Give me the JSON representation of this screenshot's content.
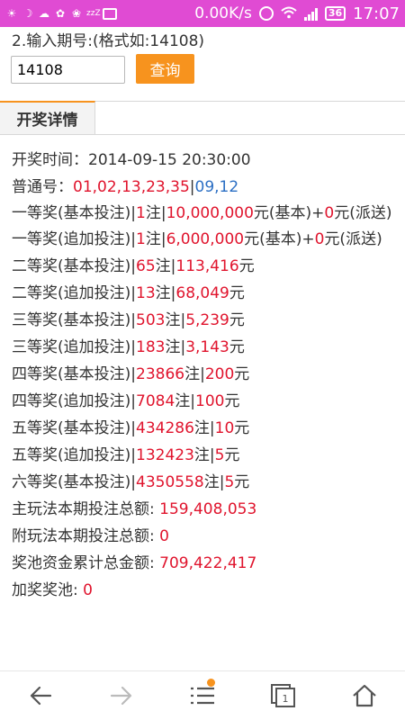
{
  "status_bar": {
    "speed": "0.00K/s",
    "battery": "36",
    "time": "17:07",
    "notification_icons": [
      "sun-icon",
      "moon-icon",
      "cloud-icon",
      "flower-icon",
      "flower-icon",
      "sleep-icon",
      "image-icon"
    ]
  },
  "query": {
    "hint": "2.输入期号:(格式如:14108)",
    "input_value": "14108",
    "button_label": "查询"
  },
  "tab": {
    "label": "开奖详情"
  },
  "results": {
    "draw_time_label": "开奖时间：",
    "draw_time": "2014-09-15 20:30:00",
    "numbers_label": "普通号：",
    "front_numbers": "01,02,13,23,35",
    "separator": "|",
    "back_numbers": "09,12",
    "prizes": [
      {
        "name": "一等奖(基本投注)|",
        "count": "1",
        "unit": "注|",
        "amount": "10,000,000",
        "suffix": "元(基本)+",
        "extra": "0",
        "extra_suffix": "元(派送)"
      },
      {
        "name": "一等奖(追加投注)|",
        "count": "1",
        "unit": "注|",
        "amount": "6,000,000",
        "suffix": "元(基本)+",
        "extra": "0",
        "extra_suffix": "元(派送)"
      },
      {
        "name": "二等奖(基本投注)|",
        "count": "65",
        "unit": "注|",
        "amount": "113,416",
        "suffix": "元"
      },
      {
        "name": "二等奖(追加投注)|",
        "count": "13",
        "unit": "注|",
        "amount": "68,049",
        "suffix": "元"
      },
      {
        "name": "三等奖(基本投注)|",
        "count": "503",
        "unit": "注|",
        "amount": "5,239",
        "suffix": "元"
      },
      {
        "name": "三等奖(追加投注)|",
        "count": "183",
        "unit": "注|",
        "amount": "3,143",
        "suffix": "元"
      },
      {
        "name": "四等奖(基本投注)|",
        "count": "23866",
        "unit": "注|",
        "amount": "200",
        "suffix": "元"
      },
      {
        "name": "四等奖(追加投注)|",
        "count": "7084",
        "unit": "注|",
        "amount": "100",
        "suffix": "元"
      },
      {
        "name": "五等奖(基本投注)|",
        "count": "434286",
        "unit": "注|",
        "amount": "10",
        "suffix": "元"
      },
      {
        "name": "五等奖(追加投注)|",
        "count": "132423",
        "unit": "注|",
        "amount": "5",
        "suffix": "元"
      },
      {
        "name": "六等奖(基本投注)|",
        "count": "4350558",
        "unit": "注|",
        "amount": "5",
        "suffix": "元"
      }
    ],
    "main_total_label": "主玩法本期投注总额: ",
    "main_total": "159,408,053",
    "sub_total_label": "附玩法本期投注总额: ",
    "sub_total": "0",
    "pool_label": "奖池资金累计总金额: ",
    "pool": "709,422,417",
    "bonus_pool_label": "加奖奖池: ",
    "bonus_pool": "0"
  },
  "nav": {
    "tab_count": "1",
    "icons": [
      "back-icon",
      "forward-icon",
      "menu-icon",
      "tabs-icon",
      "home-icon"
    ]
  },
  "colors": {
    "status_bar": "#e04bd3",
    "accent": "#f7931e",
    "highlight": "#e0142d",
    "blue_numbers": "#2c6fc4"
  }
}
